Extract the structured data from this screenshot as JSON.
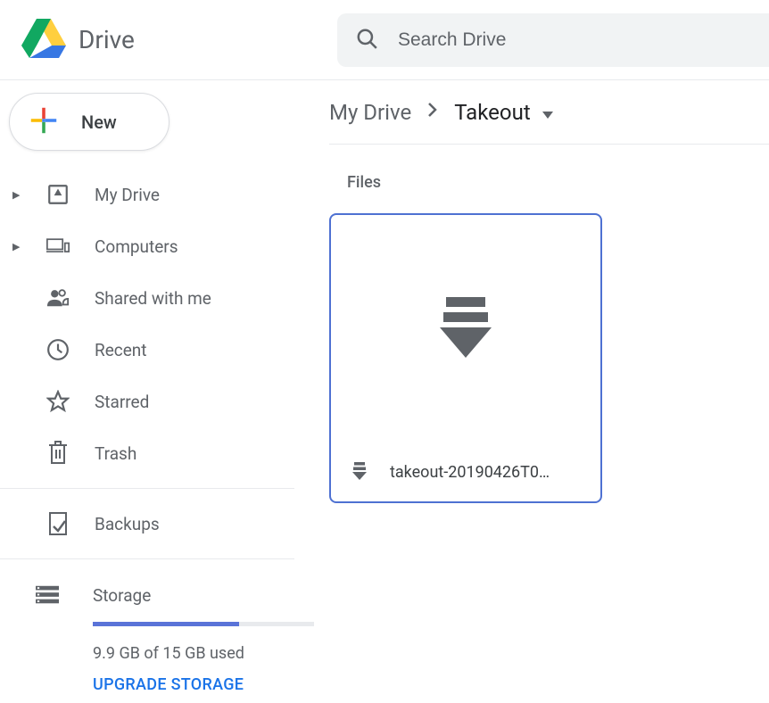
{
  "app": {
    "title": "Drive"
  },
  "search": {
    "placeholder": "Search Drive"
  },
  "new_button": {
    "label": "New"
  },
  "sidebar": {
    "items": [
      {
        "label": "My Drive",
        "has_chevron": true
      },
      {
        "label": "Computers",
        "has_chevron": true
      },
      {
        "label": "Shared with me",
        "has_chevron": false
      },
      {
        "label": "Recent",
        "has_chevron": false
      },
      {
        "label": "Starred",
        "has_chevron": false
      },
      {
        "label": "Trash",
        "has_chevron": false
      }
    ],
    "backups": {
      "label": "Backups"
    },
    "storage": {
      "label": "Storage",
      "usage_text": "9.9 GB of 15 GB used",
      "upgrade_label": "UPGRADE STORAGE",
      "percent_used": 66
    }
  },
  "breadcrumb": {
    "root": "My Drive",
    "current": "Takeout"
  },
  "main": {
    "section_label": "Files",
    "files": [
      {
        "name": "takeout-20190426T0…"
      }
    ]
  }
}
